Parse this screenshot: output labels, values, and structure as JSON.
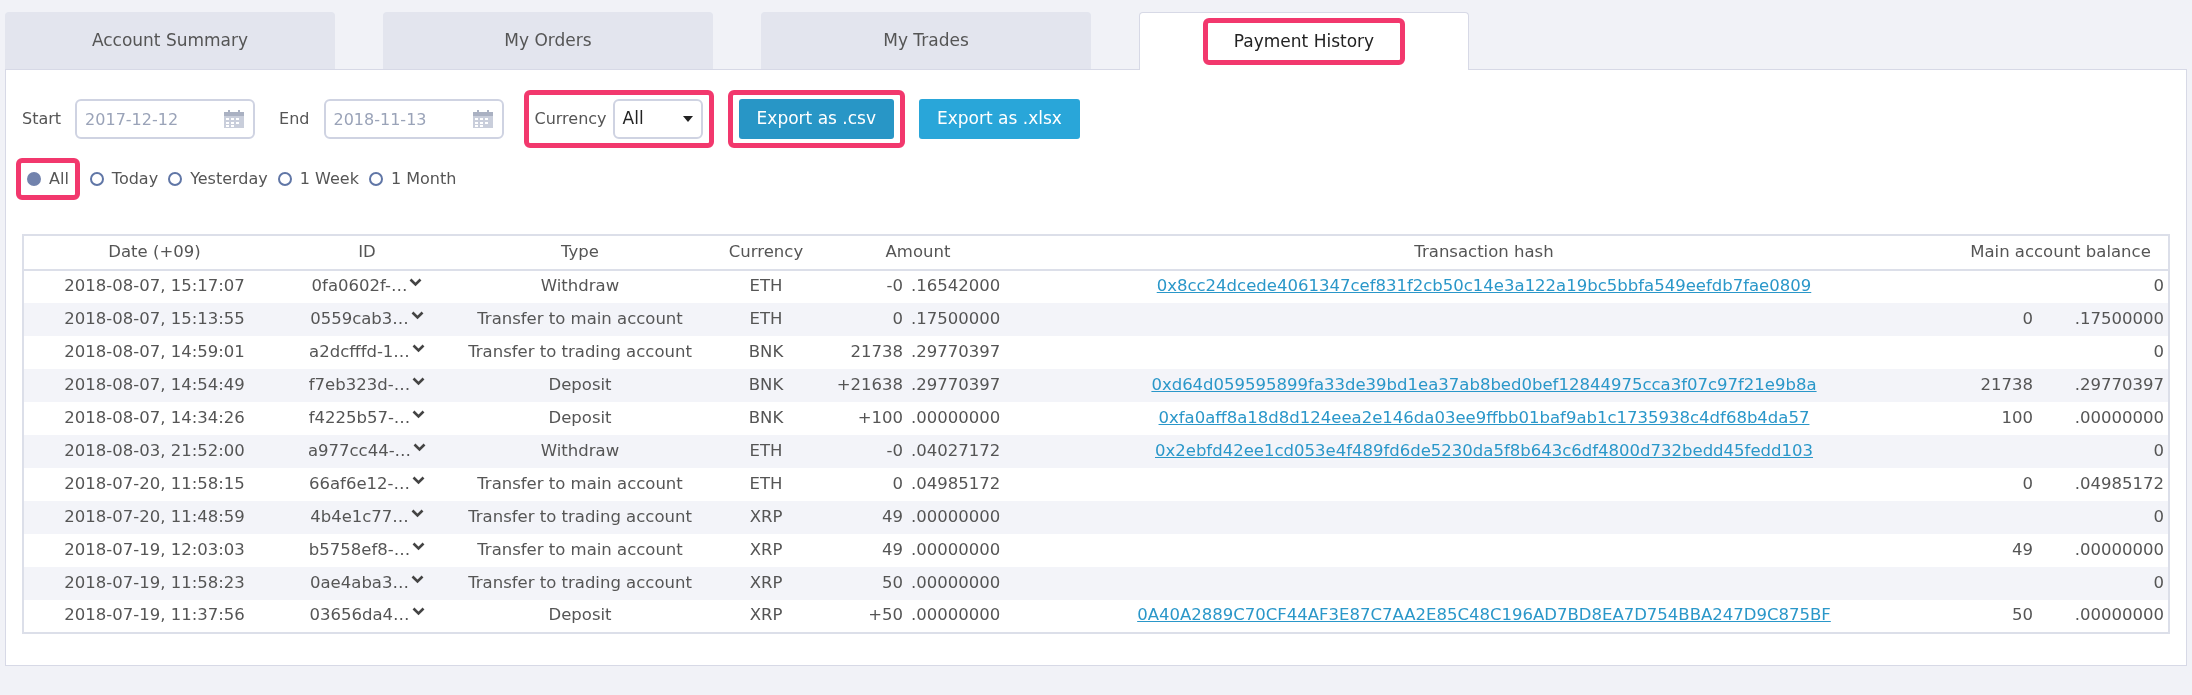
{
  "tabs": [
    {
      "label": "Account Summary",
      "selected": false,
      "highlighted": false
    },
    {
      "label": "My Orders",
      "selected": false,
      "highlighted": false
    },
    {
      "label": "My Trades",
      "selected": false,
      "highlighted": false
    },
    {
      "label": "Payment History",
      "selected": true,
      "highlighted": true
    }
  ],
  "filters": {
    "start": {
      "label": "Start",
      "value": "2017-12-12"
    },
    "end": {
      "label": "End",
      "value": "2018-11-13"
    },
    "currency": {
      "label": "Currency",
      "value": "All",
      "highlighted": true
    },
    "buttons": [
      {
        "label": "Export as .csv",
        "highlighted": true
      },
      {
        "label": "Export as .xlsx",
        "highlighted": false
      }
    ]
  },
  "ranges": [
    {
      "label": "All",
      "selected": true,
      "highlighted": true
    },
    {
      "label": "Today",
      "selected": false,
      "highlighted": false
    },
    {
      "label": "Yesterday",
      "selected": false,
      "highlighted": false
    },
    {
      "label": "1 Week",
      "selected": false,
      "highlighted": false
    },
    {
      "label": "1 Month",
      "selected": false,
      "highlighted": false
    }
  ],
  "table": {
    "columns": [
      "Date (+09)",
      "ID",
      "Type",
      "Currency",
      "Amount",
      "Transaction hash",
      "Main account balance"
    ],
    "rows": [
      {
        "date": "2018-08-07, 15:17:07",
        "id": "0fa0602f-…",
        "type": "Withdraw",
        "currency": "ETH",
        "amount_whole": "-0",
        "amount_fraction": ".16542000",
        "hash": "0x8cc24dcede4061347cef831f2cb50c14e3a122a19bc5bbfa549eefdb7fae0809",
        "balance_whole": "0"
      },
      {
        "date": "2018-08-07, 15:13:55",
        "id": "0559cab3…",
        "type": "Transfer to main account",
        "currency": "ETH",
        "amount_whole": "0",
        "amount_fraction": ".17500000",
        "balance_whole": "0",
        "balance_fraction": ".17500000"
      },
      {
        "date": "2018-08-07, 14:59:01",
        "id": "a2dcfffd-1…",
        "type": "Transfer to trading account",
        "currency": "BNK",
        "amount_whole": "21738",
        "amount_fraction": ".29770397",
        "balance_whole": "0"
      },
      {
        "date": "2018-08-07, 14:54:49",
        "id": "f7eb323d-…",
        "type": "Deposit",
        "currency": "BNK",
        "amount_whole": "+21638",
        "amount_fraction": ".29770397",
        "hash": "0xd64d059595899fa33de39bd1ea37ab8bed0bef12844975cca3f07c97f21e9b8a",
        "balance_whole": "21738",
        "balance_fraction": ".29770397"
      },
      {
        "date": "2018-08-07, 14:34:26",
        "id": "f4225b57-…",
        "type": "Deposit",
        "currency": "BNK",
        "amount_whole": "+100",
        "amount_fraction": ".00000000",
        "hash": "0xfa0aff8a18d8d124eea2e146da03ee9ffbb01baf9ab1c1735938c4df68b4da57",
        "balance_whole": "100",
        "balance_fraction": ".00000000"
      },
      {
        "date": "2018-08-03, 21:52:00",
        "id": "a977cc44-…",
        "type": "Withdraw",
        "currency": "ETH",
        "amount_whole": "-0",
        "amount_fraction": ".04027172",
        "hash": "0x2ebfd42ee1cd053e4f489fd6de5230da5f8b643c6df4800d732bedd45fedd103",
        "balance_whole": "0"
      },
      {
        "date": "2018-07-20, 11:58:15",
        "id": "66af6e12-…",
        "type": "Transfer to main account",
        "currency": "ETH",
        "amount_whole": "0",
        "amount_fraction": ".04985172",
        "balance_whole": "0",
        "balance_fraction": ".04985172"
      },
      {
        "date": "2018-07-20, 11:48:59",
        "id": "4b4e1c77…",
        "type": "Transfer to trading account",
        "currency": "XRP",
        "amount_whole": "49",
        "amount_fraction": ".00000000",
        "balance_whole": "0"
      },
      {
        "date": "2018-07-19, 12:03:03",
        "id": "b5758ef8-…",
        "type": "Transfer to main account",
        "currency": "XRP",
        "amount_whole": "49",
        "amount_fraction": ".00000000",
        "balance_whole": "49",
        "balance_fraction": ".00000000"
      },
      {
        "date": "2018-07-19, 11:58:23",
        "id": "0ae4aba3…",
        "type": "Transfer to trading account",
        "currency": "XRP",
        "amount_whole": "50",
        "amount_fraction": ".00000000",
        "balance_whole": "0"
      },
      {
        "date": "2018-07-19, 11:37:56",
        "id": "03656da4…",
        "type": "Deposit",
        "currency": "XRP",
        "amount_whole": "+50",
        "amount_fraction": ".00000000",
        "hash": "0A40A2889C70CF44AF3E87C7AA2E85C48C196AD7BD8EA7D754BBA247D9C875BF",
        "balance_whole": "50",
        "balance_fraction": ".00000000"
      }
    ]
  }
}
